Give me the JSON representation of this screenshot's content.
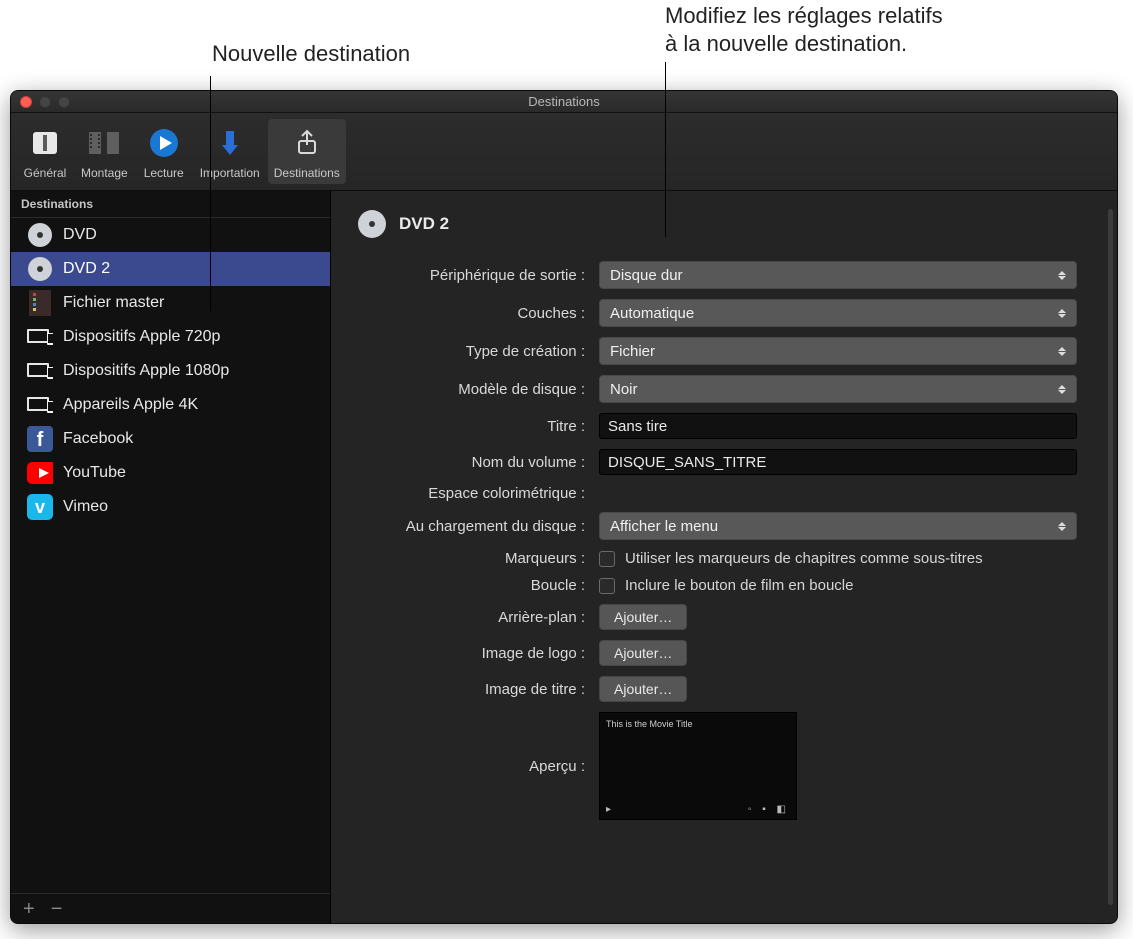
{
  "annotations": {
    "left": "Nouvelle destination",
    "right_l1": "Modifiez les réglages relatifs",
    "right_l2": "à la nouvelle destination."
  },
  "window": {
    "title": "Destinations"
  },
  "toolbar": {
    "general": "Général",
    "editing": "Montage",
    "playback": "Lecture",
    "import": "Importation",
    "destinations": "Destinations"
  },
  "sidebar": {
    "header": "Destinations",
    "items": [
      {
        "label": "DVD",
        "icon": "disc",
        "selected": false
      },
      {
        "label": "DVD 2",
        "icon": "disc",
        "selected": true
      },
      {
        "label": "Fichier master",
        "icon": "film",
        "selected": false
      },
      {
        "label": "Dispositifs Apple 720p",
        "icon": "devices",
        "selected": false
      },
      {
        "label": "Dispositifs Apple 1080p",
        "icon": "devices",
        "selected": false
      },
      {
        "label": "Appareils Apple 4K",
        "icon": "devices",
        "selected": false
      },
      {
        "label": "Facebook",
        "icon": "facebook",
        "selected": false
      },
      {
        "label": "YouTube",
        "icon": "youtube",
        "selected": false
      },
      {
        "label": "Vimeo",
        "icon": "vimeo",
        "selected": false
      }
    ],
    "add": "+",
    "remove": "−"
  },
  "detail": {
    "title": "DVD 2",
    "labels": {
      "output_device": "Périphérique de sortie :",
      "layers": "Couches :",
      "build_type": "Type de création :",
      "disc_template": "Modèle de disque :",
      "title": "Titre :",
      "volume_name": "Nom du volume :",
      "color_space": "Espace colorimétrique :",
      "on_disc_load": "Au chargement du disque :",
      "markers": "Marqueurs :",
      "loop": "Boucle :",
      "background": "Arrière-plan :",
      "logo_image": "Image de logo :",
      "title_image": "Image de titre :",
      "preview": "Aperçu :"
    },
    "values": {
      "output_device": "Disque dur",
      "layers": "Automatique",
      "build_type": "Fichier",
      "disc_template": "Noir",
      "title": "Sans tire",
      "volume_name": "DISQUE_SANS_TITRE",
      "on_disc_load": "Afficher le menu",
      "markers_checkbox": "Utiliser les marqueurs de chapitres comme sous-titres",
      "loop_checkbox": "Inclure le bouton de film en boucle",
      "add_button": "Ajouter…",
      "preview_movie_title": "This is the Movie Title"
    }
  }
}
